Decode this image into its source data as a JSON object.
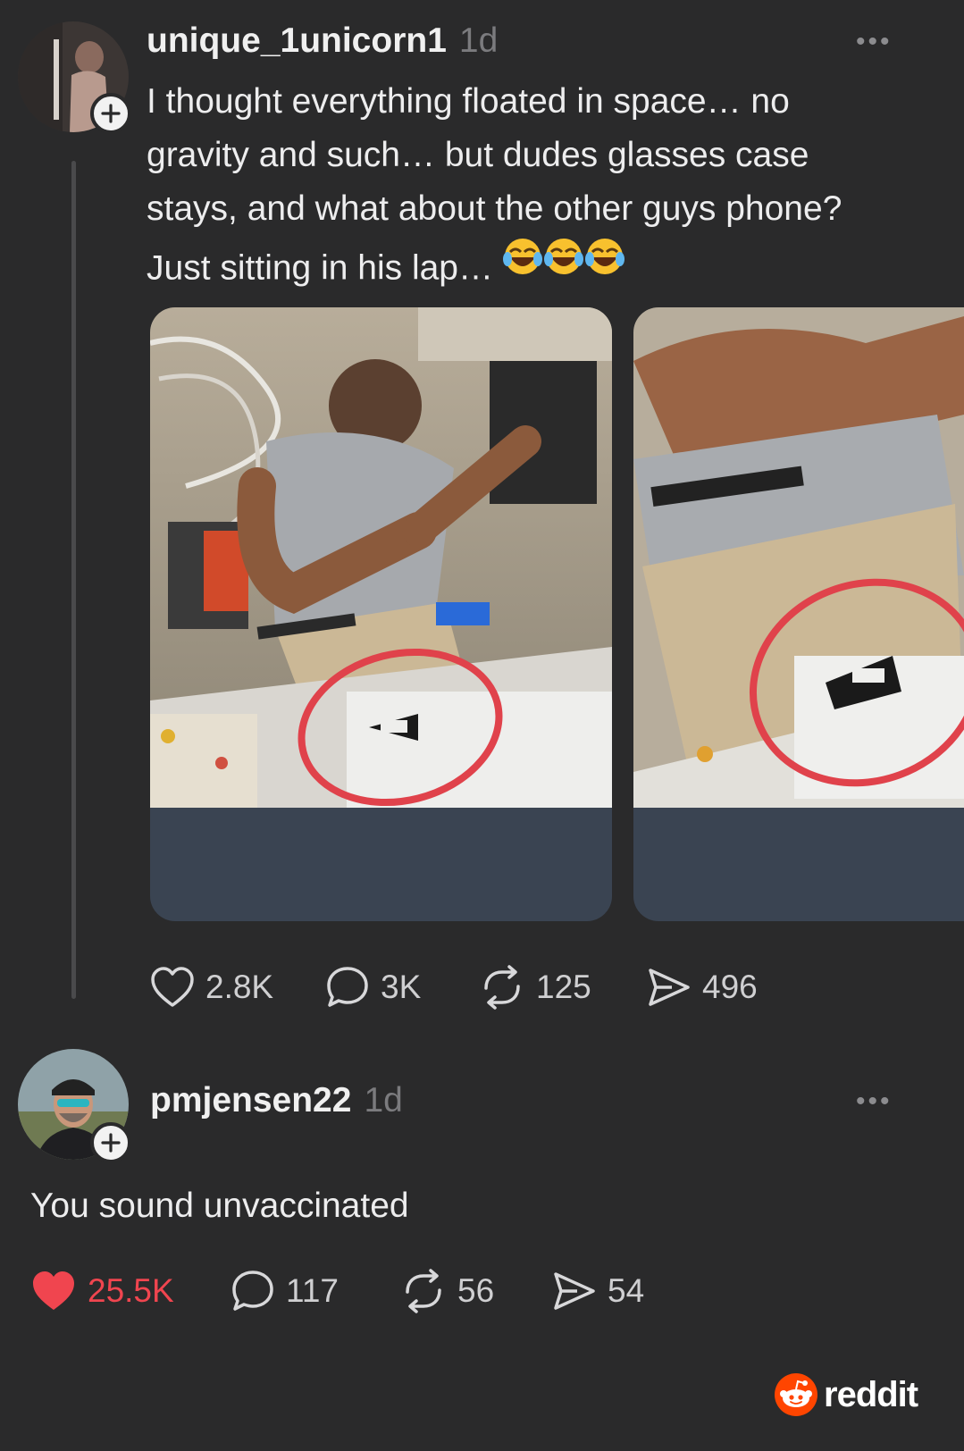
{
  "post": {
    "username": "unique_1unicorn1",
    "time": "1d",
    "menu": "•••",
    "text_lines": [
      "I thought everything floated in space… no",
      "gravity and such… but dudes glasses case",
      "stays, and what about the other guys phone?",
      "Just sitting in his lap…"
    ],
    "emoji": "😂😂😂",
    "actions": {
      "likes": "2.8K",
      "comments": "3K",
      "reposts": "125",
      "shares": "496"
    }
  },
  "reply": {
    "username": "pmjensen22",
    "time": "1d",
    "menu": "•••",
    "text": "You sound unvaccinated",
    "actions": {
      "likes": "25.5K",
      "comments": "117",
      "reposts": "56",
      "shares": "54"
    }
  },
  "watermark": {
    "label": "reddit"
  },
  "colors": {
    "background": "#2a2a2b",
    "liked": "#f0454f",
    "reddit_orange": "#ff4500",
    "circle_annotation": "#e0424b"
  }
}
